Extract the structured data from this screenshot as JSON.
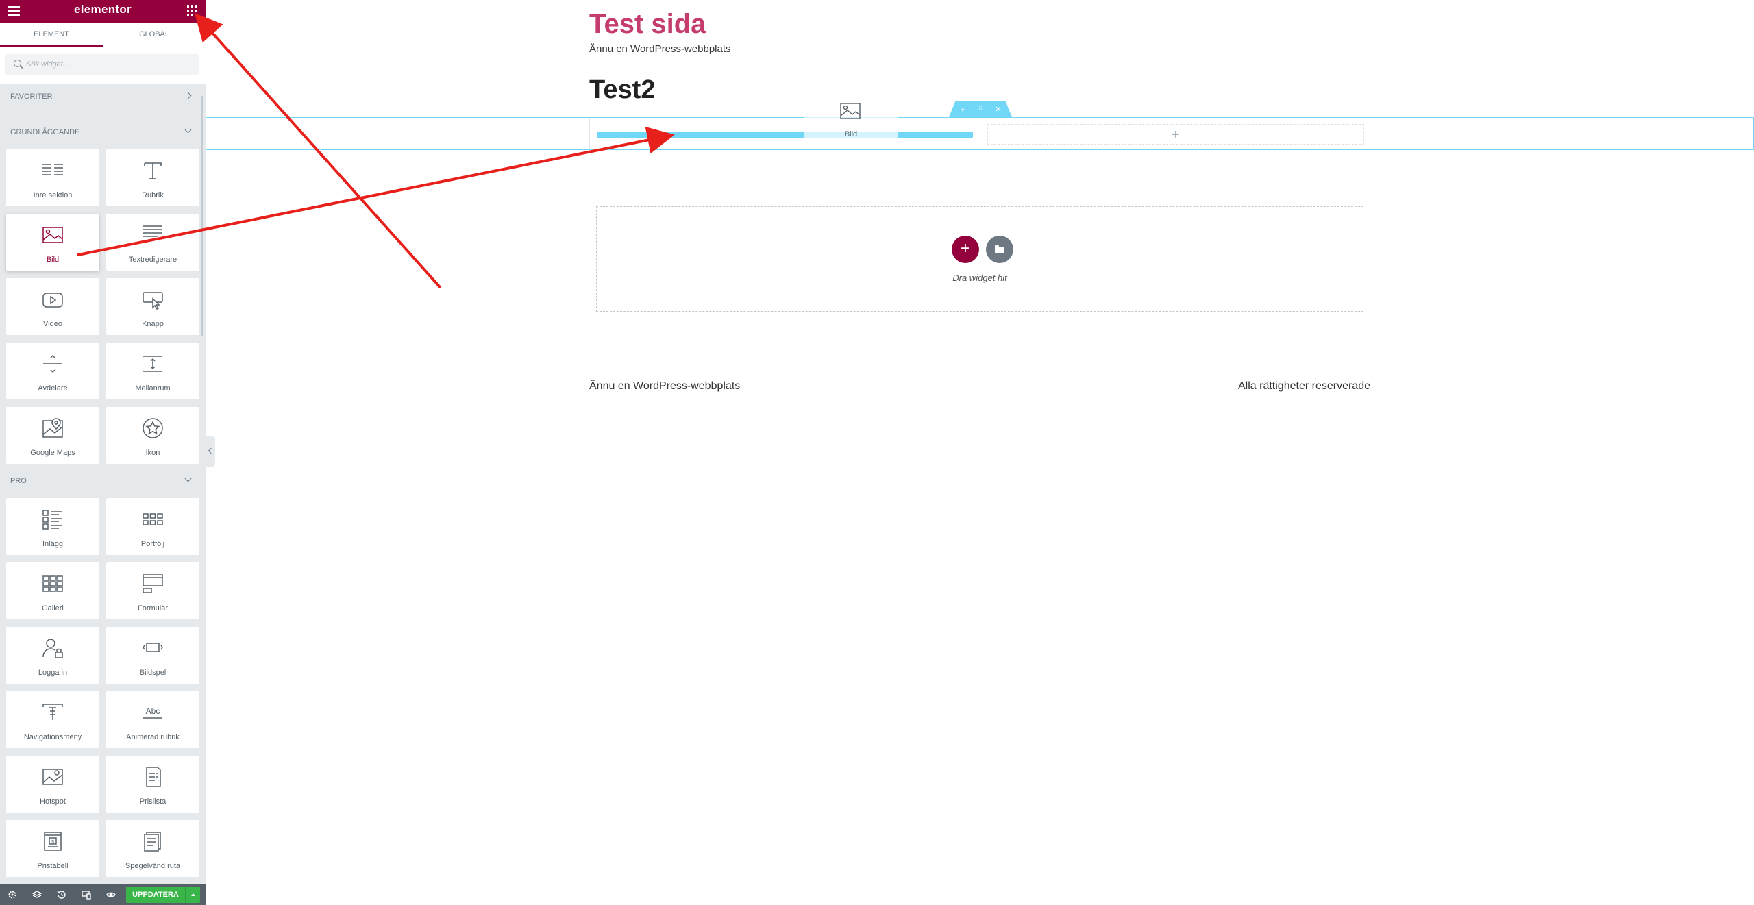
{
  "panel": {
    "logo": "elementor",
    "tabs": [
      {
        "label": "ELEMENT"
      },
      {
        "label": "GLOBAL"
      }
    ],
    "search_placeholder": "Sök widget...",
    "categories": {
      "favorites": "FAVORITER",
      "basic": "GRUNDLÄGGANDE",
      "pro": "PRO"
    },
    "basic_widgets": [
      {
        "label": "Inre sektion",
        "icon": "columns-icon"
      },
      {
        "label": "Rubrik",
        "icon": "heading-icon"
      },
      {
        "label": "Bild",
        "icon": "image-icon"
      },
      {
        "label": "Textredigerare",
        "icon": "text-editor-icon"
      },
      {
        "label": "Video",
        "icon": "video-icon"
      },
      {
        "label": "Knapp",
        "icon": "button-icon"
      },
      {
        "label": "Avdelare",
        "icon": "divider-icon"
      },
      {
        "label": "Mellanrum",
        "icon": "spacer-icon"
      },
      {
        "label": "Google Maps",
        "icon": "map-icon"
      },
      {
        "label": "Ikon",
        "icon": "star-icon"
      }
    ],
    "pro_widgets": [
      {
        "label": "Inlägg",
        "icon": "posts-icon"
      },
      {
        "label": "Portfölj",
        "icon": "portfolio-icon"
      },
      {
        "label": "Galleri",
        "icon": "gallery-icon"
      },
      {
        "label": "Formulär",
        "icon": "form-icon"
      },
      {
        "label": "Logga in",
        "icon": "login-icon"
      },
      {
        "label": "Bildspel",
        "icon": "slides-icon"
      },
      {
        "label": "Navigationsmeny",
        "icon": "nav-menu-icon"
      },
      {
        "label": "Animerad rubrik",
        "icon": "animated-heading-icon"
      },
      {
        "label": "Hotspot",
        "icon": "hotspot-icon"
      },
      {
        "label": "Prislista",
        "icon": "price-list-icon"
      },
      {
        "label": "Pristabell",
        "icon": "price-table-icon"
      },
      {
        "label": "Spegelvänd ruta",
        "icon": "flip-box-icon"
      }
    ],
    "footer": {
      "update_label": "UPPDATERA"
    }
  },
  "preview": {
    "site_title": "Test sida",
    "tagline": "Ännu en WordPress-webbplats",
    "page_title": "Test2",
    "section_handle": {
      "add": "+",
      "move": "⠿",
      "close": "×"
    },
    "drag_ghost_label": "Bild",
    "drop_hint": "Dra widget hit",
    "footer_left": "Ännu en WordPress-webbplats",
    "footer_right": "Alla rättigheter reserverade"
  },
  "colors": {
    "brand": "#93003c",
    "accent": "#71d7f7",
    "update": "#39b54a",
    "arrow": "#e8201c",
    "title": "#c43d6e"
  }
}
